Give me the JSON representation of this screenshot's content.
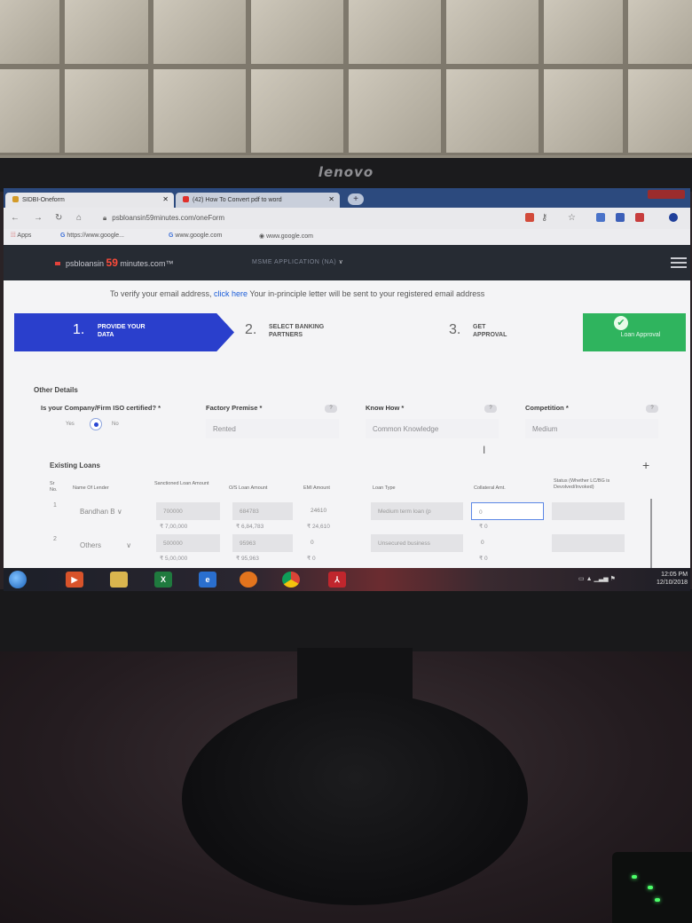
{
  "scene": {
    "monitor_brand": "lenovo"
  },
  "browser": {
    "tabs": [
      {
        "title": "SIDBI-Oneform"
      },
      {
        "title": "(42) How To Convert pdf to word"
      }
    ],
    "url": "psbloansin59minutes.com/oneForm",
    "bookmarks": [
      "Apps",
      "https://www.google...",
      "www.google.com",
      "www.google.com"
    ]
  },
  "header": {
    "logo_prefix": "psbloansin",
    "logo_number": "59",
    "logo_suffix": "minutes.com™",
    "nav_label": "MSME APPLICATION (NA)"
  },
  "notice": {
    "text_before": "To verify your email address, ",
    "link": "click here",
    "text_after": " Your in-principle letter will be sent to your registered email address"
  },
  "steps": [
    {
      "num": "1.",
      "label": "PROVIDE YOUR DATA"
    },
    {
      "num": "2.",
      "label": "SELECT BANKING PARTNERS"
    },
    {
      "num": "3.",
      "label": "GET APPROVAL"
    },
    {
      "num": "",
      "label": "Loan Approval"
    }
  ],
  "other_details": {
    "title": "Other Details",
    "iso_label": "Is your Company/Firm ISO certified? *",
    "iso_yes": "Yes",
    "iso_no": "No",
    "factory_label": "Factory Premise *",
    "factory_value": "Rented",
    "knowhow_label": "Know How *",
    "knowhow_value": "Common Knowledge",
    "competition_label": "Competition *",
    "competition_value": "Medium",
    "help_glyph": "?"
  },
  "existing_loans": {
    "title": "Existing Loans",
    "add_glyph": "+",
    "columns": [
      "Sr No.",
      "Name Of Lender",
      "Sanctioned Loan Amount",
      "O/S Loan Amount",
      "EMI Amount",
      "Loan Type",
      "Collateral Amt.",
      "Status (Whether LC/BG is Devolved/Invoked)"
    ],
    "rows": [
      {
        "sr": "1",
        "lender": "Bandhan B",
        "sanctioned": "700000",
        "sanctioned_fmt": "₹ 7,00,000",
        "outstanding": "684783",
        "outstanding_fmt": "₹ 6,84,783",
        "emi": "24610",
        "emi_fmt": "₹ 24,610",
        "loan_type": "Medium term loan (p",
        "collateral": "0",
        "collateral_fmt": "₹ 0"
      },
      {
        "sr": "2",
        "lender": "Others",
        "sanctioned": "500000",
        "sanctioned_fmt": "₹ 5,00,000",
        "outstanding": "95963",
        "outstanding_fmt": "₹ 95,963",
        "emi": "0",
        "emi_fmt": "₹ 0",
        "loan_type": "Unsecured business",
        "collateral": "0",
        "collateral_fmt": "₹ 0"
      }
    ]
  },
  "taskbar": {
    "time": "12:05 PM",
    "date": "12/10/2018",
    "icons": [
      "media-player",
      "file-explorer",
      "excel",
      "internet-explorer",
      "firefox",
      "chrome",
      "acrobat"
    ]
  }
}
